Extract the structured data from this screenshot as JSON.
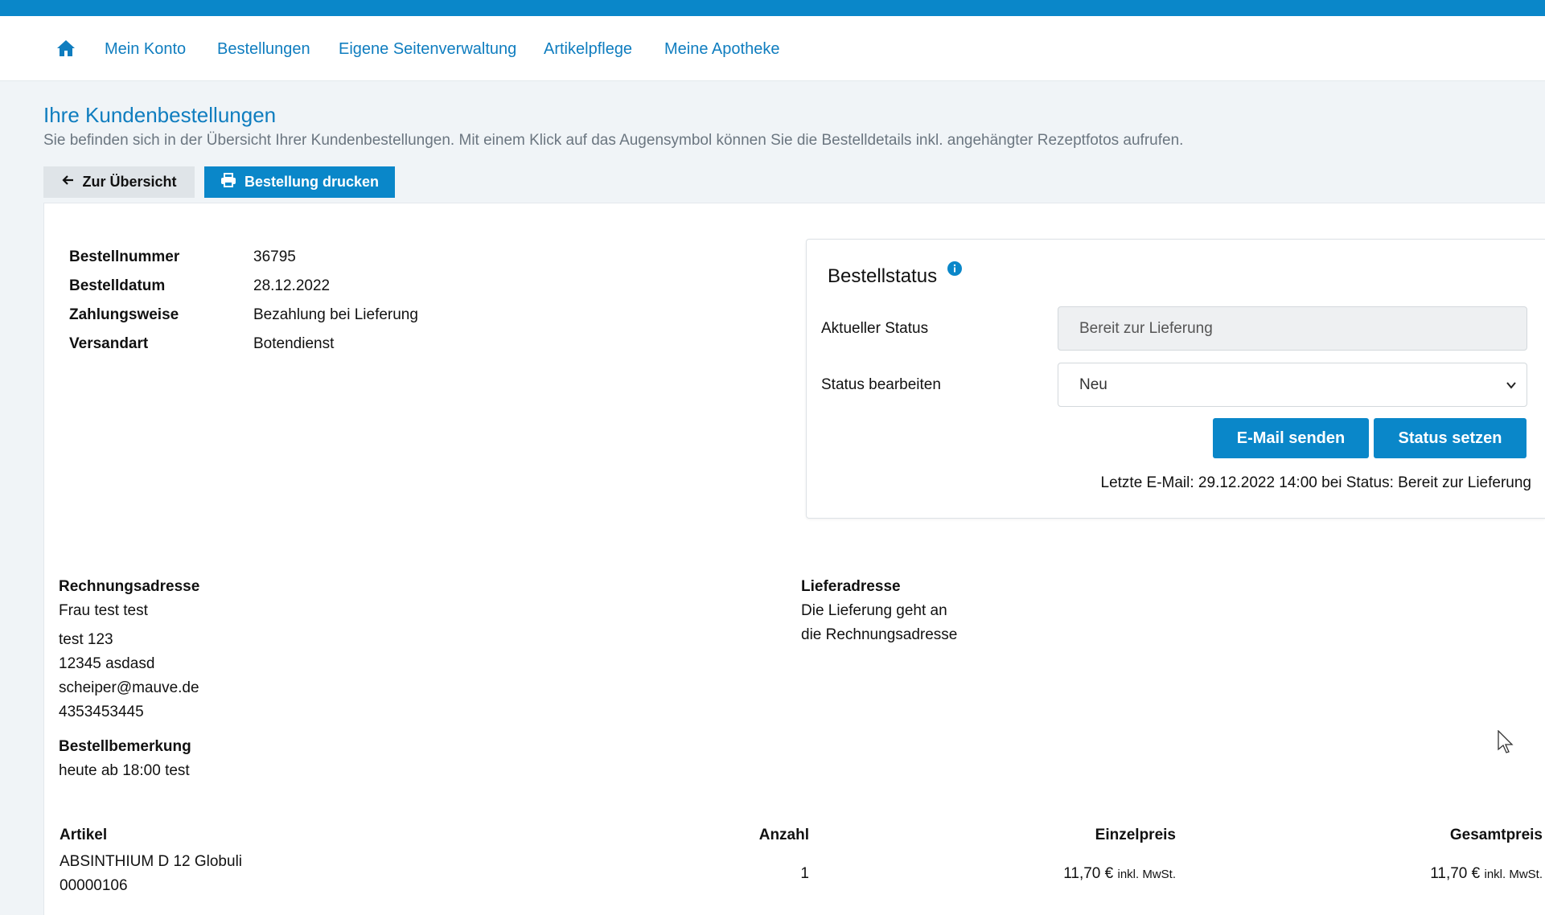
{
  "nav": {
    "items": [
      "Mein Konto",
      "Bestellungen",
      "Eigene Seitenverwaltung",
      "Artikelpflege",
      "Meine Apotheke"
    ]
  },
  "header": {
    "title": "Ihre Kundenbestellungen",
    "subtitle": "Sie befinden sich in der Übersicht Ihrer Kundenbestellungen. Mit einem Klick auf das Augensymbol können Sie die Bestelldetails inkl. angehängter Rezeptfotos aufrufen."
  },
  "actions": {
    "back_label": "Zur Übersicht",
    "print_label": "Bestellung drucken"
  },
  "order": {
    "number_label": "Bestellnummer",
    "number": "36795",
    "date_label": "Bestelldatum",
    "date": "28.12.2022",
    "payment_label": "Zahlungsweise",
    "payment": "Bezahlung bei Lieferung",
    "shipping_label": "Versandart",
    "shipping": "Botendienst"
  },
  "status": {
    "title": "Bestellstatus",
    "current_label": "Aktueller Status",
    "current_value": "Bereit zur Lieferung",
    "edit_label": "Status bearbeiten",
    "edit_value": "Neu",
    "email_button": "E-Mail senden",
    "set_button": "Status setzen",
    "last_email": "Letzte E-Mail: 29.12.2022 14:00 bei Status: Bereit zur Lieferung"
  },
  "billing": {
    "heading": "Rechnungsadresse",
    "name": "Frau test test",
    "street": "test 123",
    "city": "12345 asdasd",
    "email": "scheiper@mauve.de",
    "phone": "4353453445"
  },
  "note": {
    "heading": "Bestellbemerkung",
    "text": "heute ab 18:00 test"
  },
  "delivery": {
    "heading": "Lieferadresse",
    "line1": "Die Lieferung geht an",
    "line2": "die Rechnungsadresse"
  },
  "items": {
    "headers": {
      "article": "Artikel",
      "qty": "Anzahl",
      "unit": "Einzelpreis",
      "total": "Gesamtpreis"
    },
    "rows": [
      {
        "name": "ABSINTHIUM D 12 Globuli",
        "pzn": "00000106",
        "qty": "1",
        "unit_price": "11,70 €",
        "total_price": "11,70 €",
        "tax_note": "inkl. MwSt."
      }
    ]
  },
  "colors": {
    "accent": "#0a87c9",
    "link": "#0f7dbf",
    "background": "#f0f4f7"
  }
}
